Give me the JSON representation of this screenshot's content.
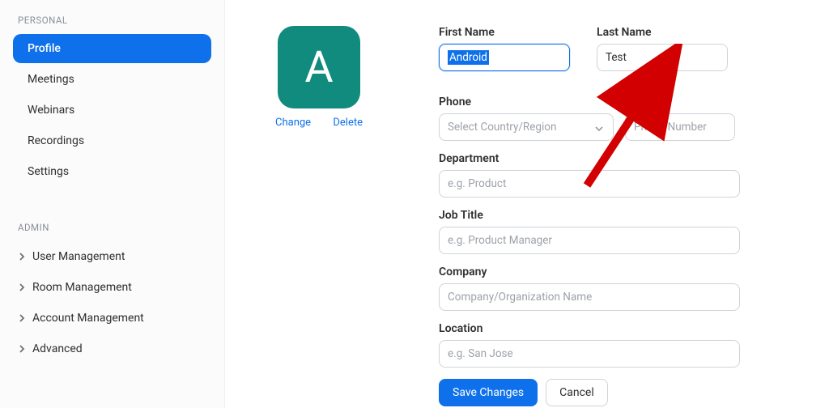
{
  "sidebar": {
    "personal_header": "PERSONAL",
    "items": [
      {
        "label": "Profile",
        "active": true
      },
      {
        "label": "Meetings",
        "active": false
      },
      {
        "label": "Webinars",
        "active": false
      },
      {
        "label": "Recordings",
        "active": false
      },
      {
        "label": "Settings",
        "active": false
      }
    ],
    "admin_header": "ADMIN",
    "admin_items": [
      {
        "label": "User Management"
      },
      {
        "label": "Room Management"
      },
      {
        "label": "Account Management"
      },
      {
        "label": "Advanced"
      }
    ]
  },
  "avatar": {
    "letter": "A",
    "change_label": "Change",
    "delete_label": "Delete"
  },
  "form": {
    "first_name_label": "First Name",
    "first_name_value": "Android",
    "last_name_label": "Last Name",
    "last_name_value": "Test",
    "phone_label": "Phone",
    "phone_country_placeholder": "Select Country/Region",
    "phone_number_placeholder": "Phone Number",
    "department_label": "Department",
    "department_placeholder": "e.g. Product",
    "job_title_label": "Job Title",
    "job_title_placeholder": "e.g. Product Manager",
    "company_label": "Company",
    "company_placeholder": "Company/Organization Name",
    "location_label": "Location",
    "location_placeholder": "e.g. San Jose",
    "save_label": "Save Changes",
    "cancel_label": "Cancel"
  },
  "colors": {
    "primary": "#0e71eb",
    "avatar_bg": "#108b7d",
    "arrow": "#d20000"
  }
}
